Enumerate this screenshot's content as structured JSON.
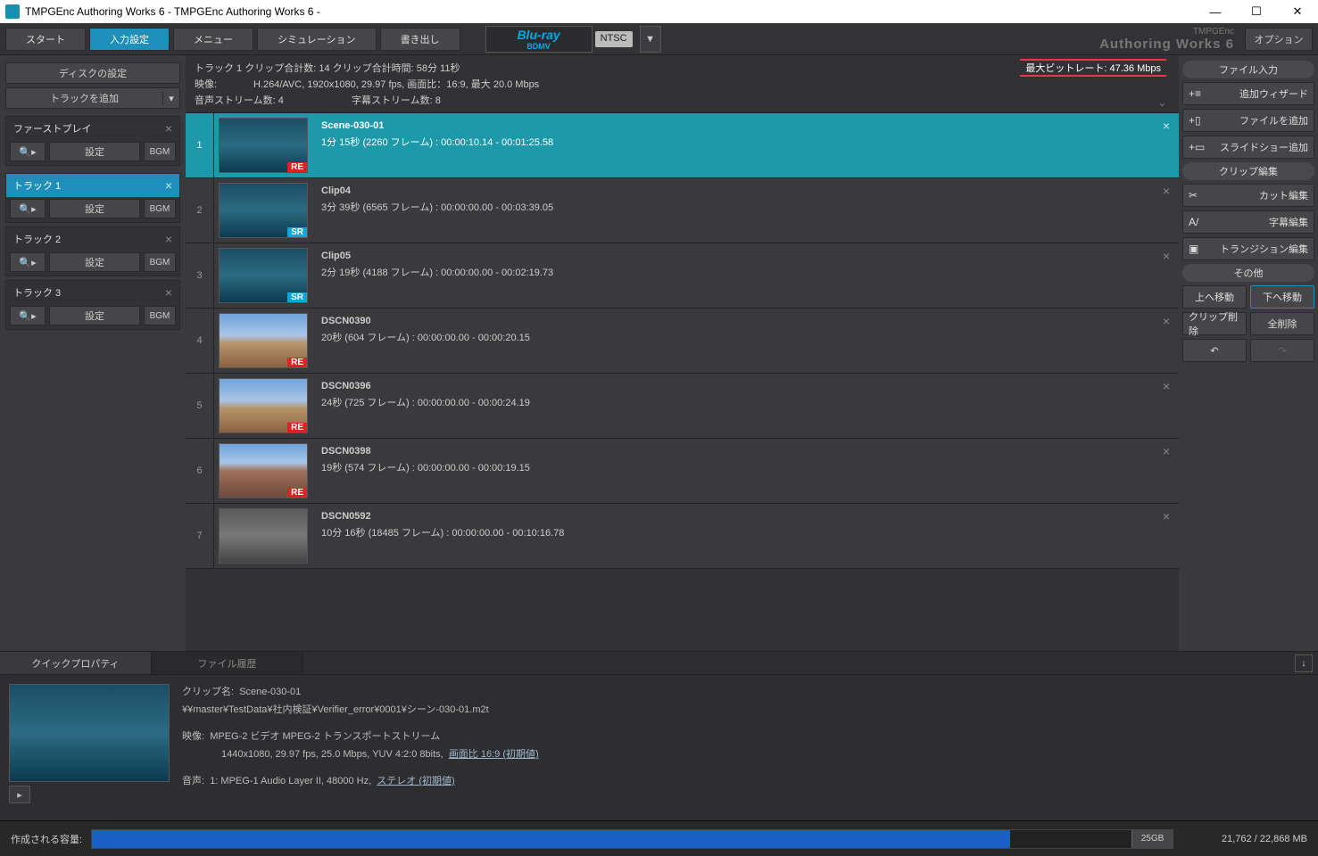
{
  "titlebar": {
    "text": "TMPGEnc Authoring Works 6 - TMPGEnc Authoring Works 6 -"
  },
  "toolbar": {
    "start": "スタート",
    "input": "入力設定",
    "menu": "メニュー",
    "simulation": "シミュレーション",
    "export": "書き出し",
    "bluray": "Blu-ray",
    "bdmv": "BDMV",
    "ntsc": "NTSC",
    "brand_small": "TMPGEnc",
    "brand_big": "Authoring Works 6",
    "option": "オプション"
  },
  "left": {
    "disc_settings": "ディスクの設定",
    "add_track": "トラックを追加",
    "firstplay": "ファーストプレイ",
    "settings": "設定",
    "bgm": "BGM",
    "tracks": [
      {
        "name": "トラック 1",
        "selected": true
      },
      {
        "name": "トラック 2",
        "selected": false
      },
      {
        "name": "トラック 3",
        "selected": false
      }
    ]
  },
  "header": {
    "line1": "トラック 1   クリップ合計数:  14     クリップ合計時間:   58分 11秒",
    "line2a": "映像:",
    "line2b": "H.264/AVC,  1920x1080,  29.97 fps,  画面比：16:9, 最大 20.0 Mbps",
    "line3a": "音声ストリーム数: 4",
    "line3b": "字幕ストリーム数: 8",
    "bitrate": "最大ビットレート: 47.36 Mbps"
  },
  "clips": [
    {
      "n": "1",
      "title": "Scene-030-01",
      "detail": "1分 15秒 (2260 フレーム) :  00:00:10.14 - 00:01:25.58",
      "tag": "RE",
      "thumb": "water",
      "selected": true
    },
    {
      "n": "2",
      "title": "Clip04",
      "detail": "3分 39秒 (6565 フレーム) :  00:00:00.00 - 00:03:39.05",
      "tag": "SR",
      "thumb": "water",
      "selected": false
    },
    {
      "n": "3",
      "title": "Clip05",
      "detail": "2分 19秒 (4188 フレーム) :  00:00:00.00 - 00:02:19.73",
      "tag": "SR",
      "thumb": "water",
      "selected": false
    },
    {
      "n": "4",
      "title": "DSCN0390",
      "detail": "20秒 (604 フレーム) :  00:00:00.00 - 00:00:20.15",
      "tag": "RE",
      "thumb": "desert",
      "selected": false
    },
    {
      "n": "5",
      "title": "DSCN0396",
      "detail": "24秒 (725 フレーム) :  00:00:00.00 - 00:00:24.19",
      "tag": "RE",
      "thumb": "desert",
      "selected": false
    },
    {
      "n": "6",
      "title": "DSCN0398",
      "detail": "19秒 (574 フレーム) :  00:00:00.00 - 00:00:19.15",
      "tag": "RE",
      "thumb": "rock",
      "selected": false
    },
    {
      "n": "7",
      "title": "DSCN0592",
      "detail": "10分 16秒 (18485 フレーム) :  00:00:00.00 - 00:10:16.78",
      "tag": "",
      "thumb": "indoor",
      "selected": false
    }
  ],
  "right": {
    "file_input": "ファイル入力",
    "add_wizard": "追加ウィザード",
    "add_file": "ファイルを追加",
    "add_slideshow": "スライドショー追加",
    "clip_edit": "クリップ編集",
    "cut_edit": "カット編集",
    "subtitle_edit": "字幕編集",
    "transition_edit": "トランジション編集",
    "other": "その他",
    "move_up": "上へ移動",
    "move_down": "下へ移動",
    "clip_delete": "クリップ削除",
    "delete_all": "全削除"
  },
  "tabs": {
    "quick": "クイックプロパティ",
    "history": "ファイル履歴"
  },
  "prop": {
    "clipname_label": "クリップ名:",
    "clipname": "Scene-030-01",
    "path": "¥¥master¥TestData¥社内検証¥Verifier_error¥0001¥シーン-030-01.m2t",
    "video_label": "映像:",
    "video1": "MPEG-2 ビデオ  MPEG-2 トランスポートストリーム",
    "video2": "1440x1080,  29.97 fps,  25.0 Mbps,  YUV 4:2:0 8bits,",
    "video2u": "画面比 16:9 (初期値)",
    "audio_label": "音声:",
    "audio1": "1:  MPEG-1 Audio Layer II, 48000 Hz,",
    "audio1u": "ステレオ (初期値)"
  },
  "status": {
    "label": "作成される容量:",
    "target": "25GB",
    "mem": "21,762 / 22,868 MB"
  }
}
